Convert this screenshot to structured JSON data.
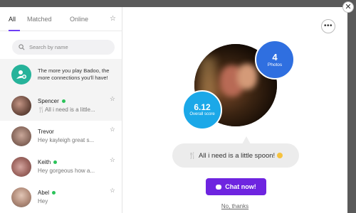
{
  "sidebar": {
    "tabs": [
      {
        "label": "All",
        "active": true
      },
      {
        "label": "Matched",
        "active": false
      },
      {
        "label": "Online",
        "active": false
      }
    ],
    "search": {
      "placeholder": "Search by name"
    },
    "promo": {
      "text": "The more you play Badoo, the more connections you'll have!"
    },
    "conversations": [
      {
        "name": "Spencer",
        "online": true,
        "message": "🍴All i need is a little..."
      },
      {
        "name": "Trevor",
        "online": false,
        "message": "Hey kayleigh great s..."
      },
      {
        "name": "Keith",
        "online": true,
        "message": "Hey gorgeous how a..."
      },
      {
        "name": "Abel",
        "online": true,
        "message": "Hey"
      }
    ]
  },
  "profile": {
    "photos": {
      "count": "4",
      "label": "Photos"
    },
    "score": {
      "value": "6.12",
      "label": "Overall score"
    },
    "message": "All i need is a little spoon!",
    "chat_button": "Chat now!",
    "decline": "No, thanks"
  },
  "colors": {
    "accent": "#6e24e0",
    "online": "#2bc35a",
    "photos_badge": "#2f6fe0",
    "score_badge": "#1ba8e8"
  }
}
